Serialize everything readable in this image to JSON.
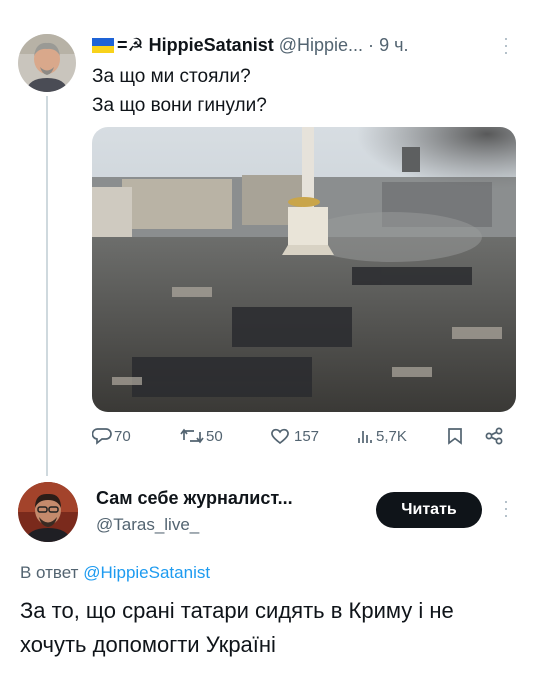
{
  "tweet": {
    "display_name": "HippieSatanist",
    "handle": "@Hippie...",
    "separator": "·",
    "time": "9 ч.",
    "text_lines": [
      "За що ми стояли?",
      "За що вони гинули?"
    ],
    "media_icon": "maidan-photo-image",
    "actions": {
      "replies": "70",
      "retweets": "50",
      "likes": "157",
      "views": "5,7K"
    },
    "flag_colors": [
      "#1e63d6",
      "#f8d21b"
    ]
  },
  "reply_author": {
    "display_name": "Сам себе журналист...",
    "handle": "@Taras_live_",
    "follow_label": "Читать"
  },
  "reply": {
    "in_reply_prefix": "В ответ",
    "in_reply_handle": "@HippieSatanist",
    "text": "За то, що срані татари сидять в Криму і не хочуть допомогти Україні"
  },
  "colors": {
    "accent": "#1d9bf0",
    "muted": "#536471",
    "button": "#0f1419"
  }
}
